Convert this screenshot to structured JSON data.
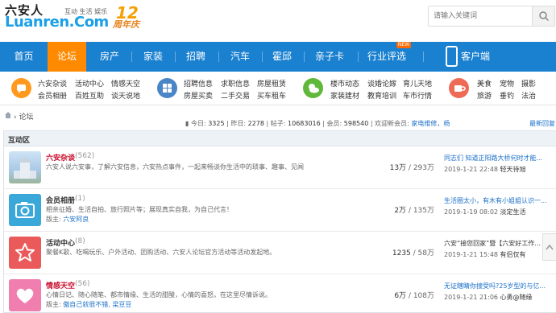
{
  "header": {
    "logo_cn": "六安人",
    "logo_en": "Luanren.Com",
    "logo_tagline": "互动 生活 娱乐",
    "anniversary_num": "12",
    "anniversary_text": "周年庆",
    "search_placeholder": "请输入关键词"
  },
  "nav": {
    "items": [
      "首页",
      "论坛",
      "房产",
      "家装",
      "招聘",
      "汽车",
      "霍邱",
      "亲子卡",
      "行业评选",
      "客户端"
    ],
    "active": "论坛",
    "new_badge": "NEW"
  },
  "quick": {
    "group1": [
      "六安杂谈",
      "活动中心",
      "情感天空",
      "会员相册",
      "百姓互助",
      "谈天说地"
    ],
    "group2": [
      "招聘信息",
      "求职信息",
      "房屋租赁",
      "房屋买卖",
      "二手交易",
      "买车租车"
    ],
    "group3": [
      "楼市动态",
      "谈婚论嫁",
      "育儿天地",
      "家装建材",
      "教育培训",
      "车市行情"
    ],
    "group4": [
      "美食",
      "宠物",
      "摄影",
      "旅游",
      "垂钓",
      "法治"
    ]
  },
  "breadcrumb": {
    "current": "论坛"
  },
  "stats": {
    "today_label": "今日:",
    "today": "3325",
    "yesterday_label": "昨日:",
    "yesterday": "2278",
    "posts_label": "帖子:",
    "posts": "10683016",
    "members_label": "会员:",
    "members": "598540",
    "newest_label": "欢迎新会员:",
    "newest_member": "家电维修，杨",
    "latest_reply": "最新回复"
  },
  "section": {
    "title": "互动区"
  },
  "forums": [
    {
      "title": "六安杂谈",
      "count": "(562)",
      "title_color": "#c8102e",
      "desc": "六安人说六安事，了解六安信息，六安热点事件，一起来畅谈你生活中的琐事、趣事、见闻",
      "mod_label": "",
      "mod": "",
      "topics": "13万",
      "posts": "293万",
      "last_title": "同志们 知道正阳路大桥何时才能...",
      "last_time": "2019-1-21 22:48",
      "last_user": "轻天待旭"
    },
    {
      "title": "会员相册",
      "count": "(1)",
      "title_color": "#333333",
      "desc": "相亲征婚、生活自拍、旅行照片等；展现真实自我，为自己代言！",
      "mod_label": "版主:",
      "mod": "六安阿良",
      "topics": "2万",
      "posts": "135万",
      "last_title": "生活圈太小，有木有小姐姐认识一...",
      "last_time": "2019-1-19 08:02",
      "last_user": "淡定生活"
    },
    {
      "title": "活动中心",
      "count": "(8)",
      "title_color": "#333333",
      "desc": "聚餐K歌、吃喝玩乐、户外活动、团购活动、六安人论坛官方活动等活动发起地。",
      "mod_label": "",
      "mod": "",
      "topics": "1235",
      "posts": "58万",
      "last_title": "六安“接您回家”暨【六安好工作...",
      "last_time": "2019-1-21 15:48",
      "last_user": "有侣仅有"
    },
    {
      "title": "情感天空",
      "count": "(56)",
      "title_color": "#c8102e",
      "desc": "心情日记、随心随笔、都市情缘、生活的甜酸，心情的喜怒，在这里尽情诉说。",
      "mod_label": "版主:",
      "mod": "傲自己就很不错, 梁豆豆",
      "topics": "6万",
      "posts": "108万",
      "last_title": "无证瞎睛你搜受吗?25岁型的与亿...",
      "last_time": "2019-1-21 21:06",
      "last_user": "心勇@随缘"
    }
  ],
  "colors": {
    "nav_bg": "#1a80d0",
    "nav_active": "#ff8a00",
    "link": "#1a6fc8"
  }
}
